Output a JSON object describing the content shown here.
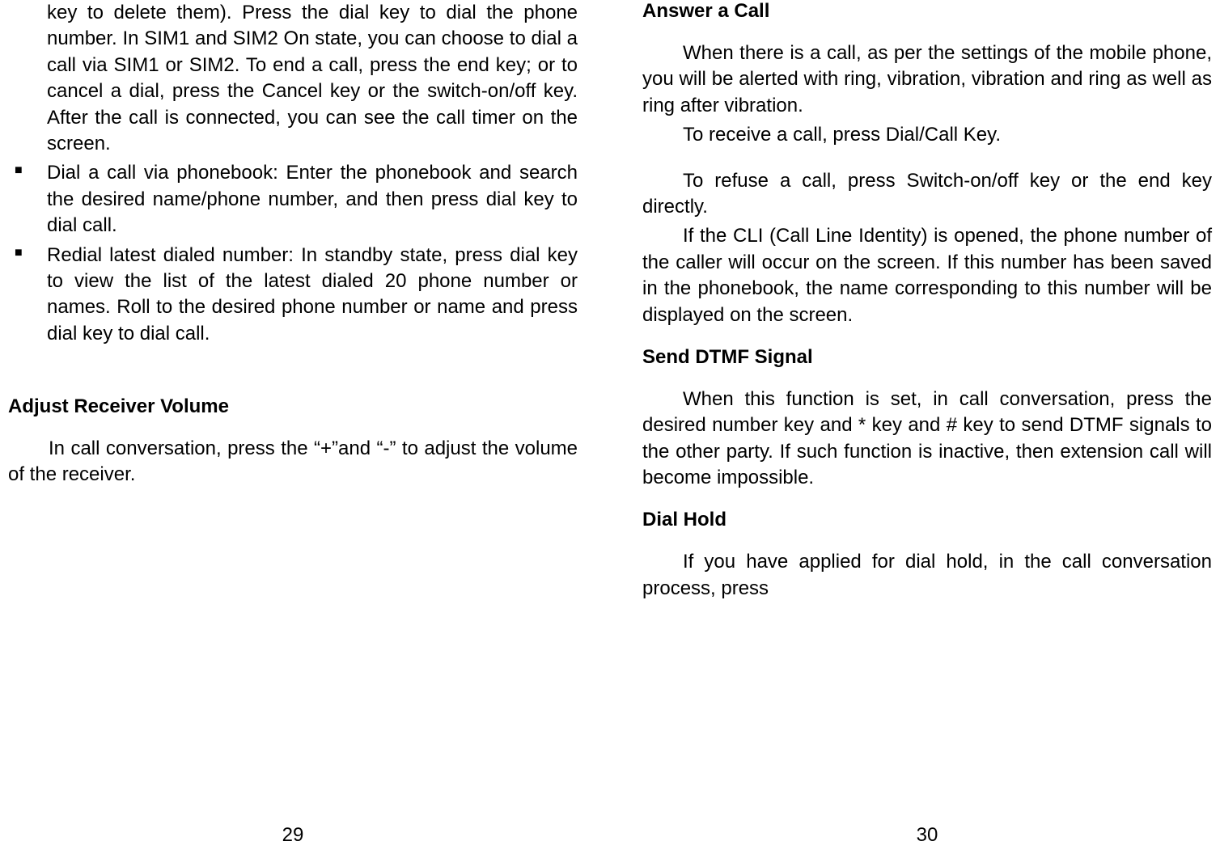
{
  "left": {
    "continued_text": "key to delete them). Press the dial key to dial the phone number. In SIM1 and SIM2 On state, you can choose to dial a call via SIM1 or SIM2. To end a call, press the end key; or to cancel a dial, press the Cancel key or the switch-on/off key. After the call is connected, you can see the call timer on the screen.",
    "bullets": [
      "Dial a call via phonebook: Enter the phonebook and search the desired name/phone number, and then press dial key to dial call.",
      "Redial latest dialed number: In standby state, press dial key to view the list of the latest dialed 20 phone number or names. Roll to the desired phone number or name and press dial key to dial call."
    ],
    "heading1": "Adjust Receiver Volume",
    "para1": "In call conversation, press the “+”and “-” to adjust the volume of the receiver.",
    "page_number": "29"
  },
  "right": {
    "heading1": "Answer a Call",
    "para1": "When there is a call, as per the settings of the mobile phone, you will be alerted with ring, vibration, vibration and ring as well as ring after vibration.",
    "para2": "To receive a call, press Dial/Call Key.",
    "para3": "To refuse a call, press Switch-on/off key or the end key directly.",
    "para4": "If the CLI (Call Line Identity) is opened, the phone number of the caller will occur on the screen. If this number has been saved in the phonebook, the name corresponding to this number will be displayed on the screen.",
    "heading2": "Send DTMF Signal",
    "para5": "When this function is set, in call conversation, press the desired number key and * key and # key to send DTMF signals to the other party. If such function is inactive, then extension call will become impossible.",
    "heading3": "Dial Hold",
    "para6": "If you have applied for dial hold, in the call conversation process, press",
    "page_number": "30"
  }
}
